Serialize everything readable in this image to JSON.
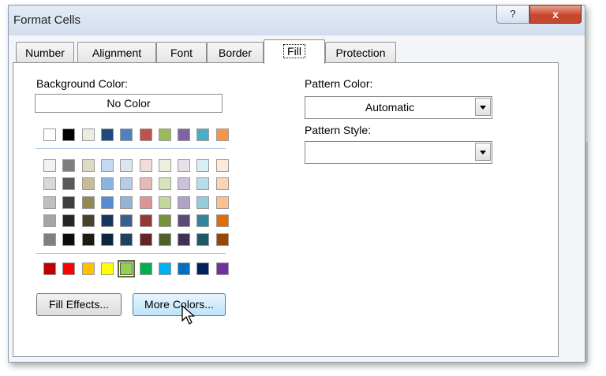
{
  "window": {
    "title": "Format Cells",
    "help_glyph": "?",
    "close_glyph": "x"
  },
  "tabs": [
    {
      "label": "Number"
    },
    {
      "label": "Alignment"
    },
    {
      "label": "Font"
    },
    {
      "label": "Border"
    },
    {
      "label": "Fill"
    },
    {
      "label": "Protection"
    }
  ],
  "active_tab": "Fill",
  "background_color": {
    "label": "Background Color:",
    "no_color_label": "No Color",
    "theme_top_row": [
      "#ffffff",
      "#000000",
      "#eeece1",
      "#1f497d",
      "#4f81bd",
      "#c0504d",
      "#9bbb59",
      "#8064a2",
      "#4bacc6",
      "#f79646"
    ],
    "theme_tints": [
      [
        "#f2f2f2",
        "#7f7f7f",
        "#ddd9c3",
        "#c6d9f0",
        "#dbe5f1",
        "#f2dcdb",
        "#ebf1dd",
        "#e5e0ec",
        "#dbeef3",
        "#fdeada"
      ],
      [
        "#d8d8d8",
        "#595959",
        "#c4bd97",
        "#8db3e2",
        "#b8cce4",
        "#e5b9b7",
        "#d7e3bc",
        "#ccc1d9",
        "#b7dde8",
        "#fbd5b5"
      ],
      [
        "#bfbfbf",
        "#3f3f3f",
        "#938953",
        "#548dd4",
        "#95b3d7",
        "#d99694",
        "#c3d69b",
        "#b2a2c7",
        "#92cddc",
        "#fac08f"
      ],
      [
        "#a5a5a5",
        "#262626",
        "#494429",
        "#17365d",
        "#366092",
        "#953734",
        "#76923c",
        "#5f497a",
        "#31859b",
        "#e36c09"
      ],
      [
        "#7f7f7f",
        "#0c0c0c",
        "#1d1b10",
        "#0f243e",
        "#244061",
        "#632423",
        "#4f6128",
        "#3f3151",
        "#205867",
        "#974806"
      ]
    ],
    "standard_colors": [
      "#c00000",
      "#ff0000",
      "#ffc000",
      "#ffff00",
      "#92d050",
      "#00b050",
      "#00b0f0",
      "#0070c0",
      "#002060",
      "#7030a0"
    ],
    "selected_standard_index": 4
  },
  "pattern_color": {
    "label": "Pattern Color:",
    "value": "Automatic"
  },
  "pattern_style": {
    "label": "Pattern Style:",
    "value": ""
  },
  "buttons": {
    "fill_effects": "Fill Effects...",
    "more_colors": "More Colors..."
  }
}
